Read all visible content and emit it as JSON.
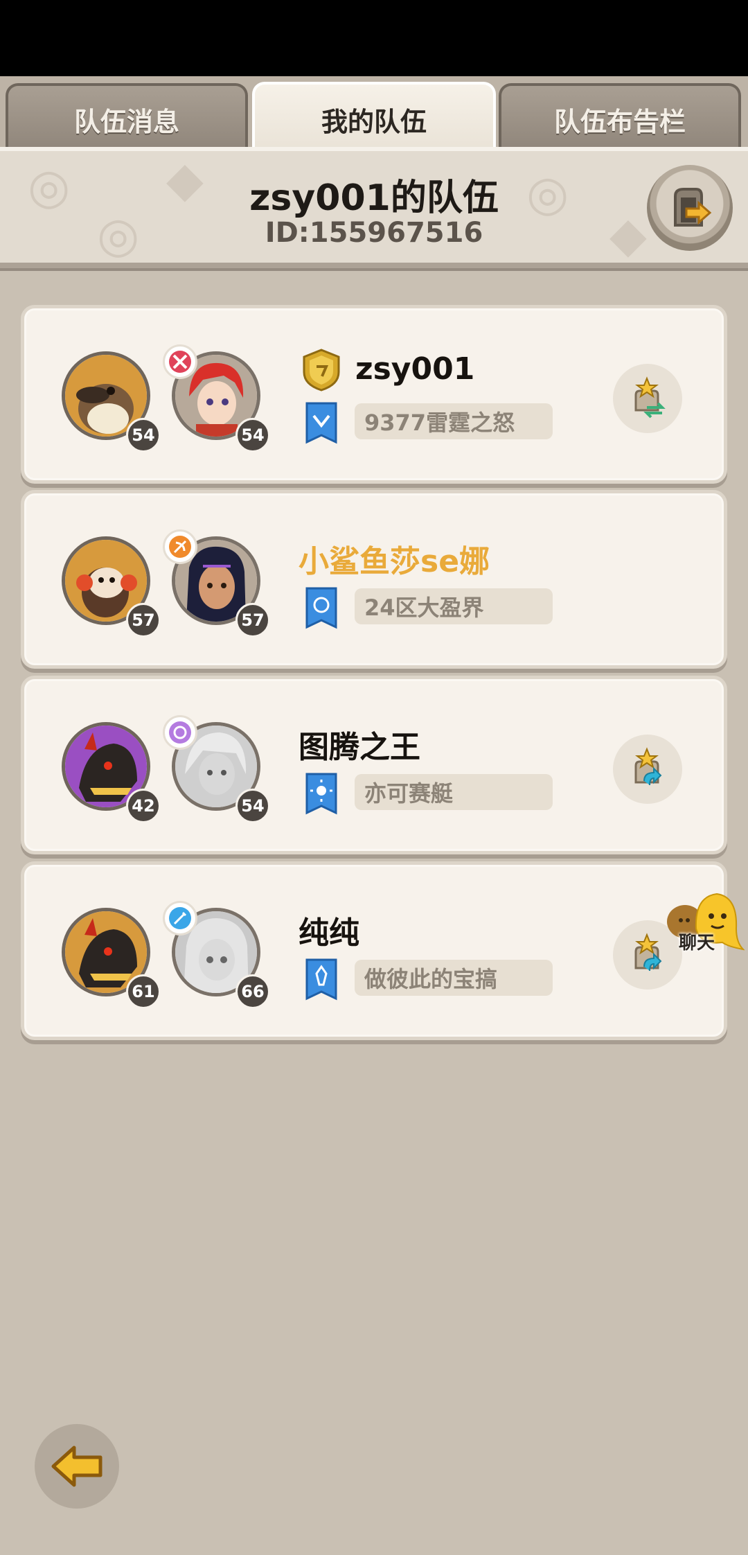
{
  "tabs": [
    {
      "label": "队伍消息",
      "active": false
    },
    {
      "label": "我的队伍",
      "active": true
    },
    {
      "label": "队伍布告栏",
      "active": false
    }
  ],
  "header": {
    "title": "zsy001的队伍",
    "id_text": "ID:155967516",
    "exit_icon": "exit-door-icon"
  },
  "members": [
    {
      "name": "zsy001",
      "name_color": "#17130f",
      "is_leader": true,
      "server": "9377雷霆之怒",
      "pet_level": "54",
      "hero_level": "54",
      "class_icon": "crossed-swords-icon",
      "class_color": "#e0435a",
      "action_icon": "transfer-icon"
    },
    {
      "name": "小鲨鱼莎se娜",
      "name_color": "#e9aa3a",
      "is_leader": false,
      "server": "24区大盈界",
      "pet_level": "57",
      "hero_level": "57",
      "class_icon": "bow-icon",
      "class_color": "#f08a2c",
      "action_icon": ""
    },
    {
      "name": "图腾之王",
      "name_color": "#17130f",
      "is_leader": false,
      "server": "亦可赛艇",
      "pet_level": "42",
      "hero_level": "54",
      "class_icon": "orb-icon",
      "class_color": "#b47be0",
      "action_icon": "swap-icon"
    },
    {
      "name": "纯纯",
      "name_color": "#17130f",
      "is_leader": false,
      "server": "做彼此的宝搞",
      "pet_level": "61",
      "hero_level": "66",
      "class_icon": "staff-icon",
      "class_color": "#3aa6e8",
      "action_icon": "swap-icon"
    }
  ],
  "chat": {
    "label": "聊天"
  },
  "footer": {
    "back_icon": "back-arrow-icon"
  }
}
